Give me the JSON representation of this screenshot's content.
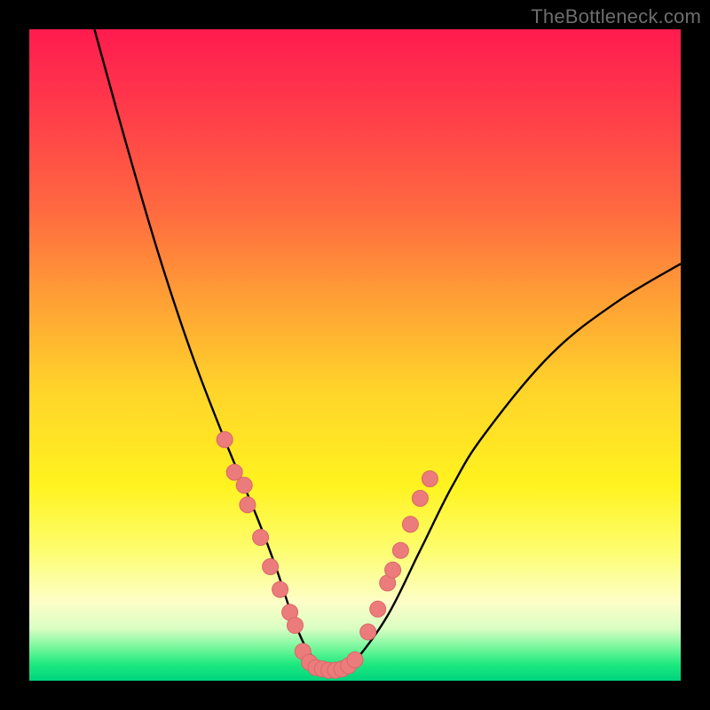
{
  "watermark": "TheBottleneck.com",
  "colors": {
    "frame": "#000000",
    "curve": "#000000",
    "dot_fill": "#ec7b7c",
    "dot_stroke": "#d96867"
  },
  "chart_data": {
    "type": "line",
    "title": "",
    "xlabel": "",
    "ylabel": "",
    "xlim": [
      0,
      100
    ],
    "ylim": [
      0,
      100
    ],
    "series": [
      {
        "name": "bottleneck-curve",
        "x": [
          10,
          15,
          20,
          25,
          30,
          35,
          38,
          40,
          42,
          44,
          46,
          48,
          50,
          55,
          60,
          65,
          70,
          80,
          90,
          100
        ],
        "y": [
          100,
          82,
          65,
          50,
          37,
          25,
          17,
          11,
          6,
          3,
          1.5,
          1.5,
          3,
          10,
          20,
          30,
          38,
          50,
          58,
          64
        ]
      }
    ],
    "points": [
      {
        "name": "left-cluster-1",
        "x": 30.0,
        "y": 37
      },
      {
        "name": "left-cluster-2",
        "x": 31.5,
        "y": 32
      },
      {
        "name": "left-cluster-3",
        "x": 33.0,
        "y": 30
      },
      {
        "name": "left-cluster-4",
        "x": 33.5,
        "y": 27
      },
      {
        "name": "left-cluster-5",
        "x": 35.5,
        "y": 22
      },
      {
        "name": "left-cluster-6",
        "x": 37.0,
        "y": 17.5
      },
      {
        "name": "left-cluster-7",
        "x": 38.5,
        "y": 14
      },
      {
        "name": "left-cluster-8",
        "x": 40.0,
        "y": 10.5
      },
      {
        "name": "left-cluster-9",
        "x": 40.8,
        "y": 8.5
      },
      {
        "name": "bottom-1",
        "x": 42.0,
        "y": 4.5
      },
      {
        "name": "bottom-2",
        "x": 43.0,
        "y": 2.8
      },
      {
        "name": "bottom-3",
        "x": 44.0,
        "y": 2.0
      },
      {
        "name": "bottom-4",
        "x": 45.0,
        "y": 1.8
      },
      {
        "name": "bottom-5",
        "x": 46.0,
        "y": 1.6
      },
      {
        "name": "bottom-6",
        "x": 47.0,
        "y": 1.6
      },
      {
        "name": "bottom-7",
        "x": 48.0,
        "y": 1.8
      },
      {
        "name": "bottom-8",
        "x": 49.0,
        "y": 2.3
      },
      {
        "name": "bottom-9",
        "x": 50.0,
        "y": 3.2
      },
      {
        "name": "right-cluster-1",
        "x": 52.0,
        "y": 7.5
      },
      {
        "name": "right-cluster-2",
        "x": 53.5,
        "y": 11
      },
      {
        "name": "right-cluster-3",
        "x": 55.0,
        "y": 15
      },
      {
        "name": "right-cluster-4",
        "x": 55.8,
        "y": 17
      },
      {
        "name": "right-cluster-5",
        "x": 57.0,
        "y": 20
      },
      {
        "name": "right-cluster-6",
        "x": 58.5,
        "y": 24
      },
      {
        "name": "right-cluster-7",
        "x": 60.0,
        "y": 28
      },
      {
        "name": "right-cluster-8",
        "x": 61.5,
        "y": 31
      }
    ]
  }
}
